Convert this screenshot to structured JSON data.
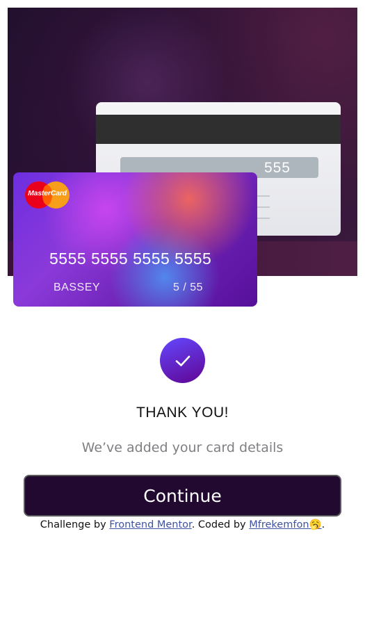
{
  "card_back": {
    "cvc": "555"
  },
  "card_front": {
    "brand": "MasterCard",
    "number": "5555 5555 5555 5555",
    "holder": "BASSEY",
    "expiry": "5 / 55"
  },
  "complete": {
    "check_icon": "check-icon",
    "heading": "THANK YOU!",
    "message": "We’ve added your card details",
    "continue_label": "Continue"
  },
  "attribution": {
    "prefix": "Challenge by ",
    "mentor_link": "Frontend Mentor",
    "middle": ". Coded by ",
    "author_link": "Mfrekemfon",
    "emoji": "🥱",
    "suffix": "."
  },
  "colors": {
    "button_bg": "#21092f",
    "link": "#3e52a3",
    "muted_text": "#7f7e82"
  }
}
